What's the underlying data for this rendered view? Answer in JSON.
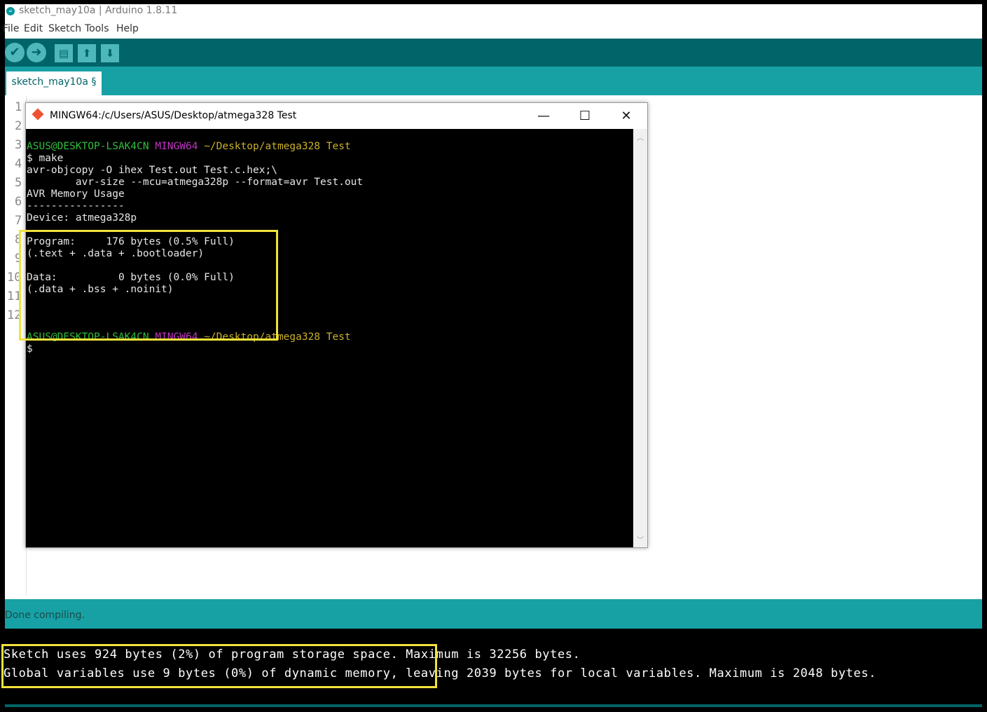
{
  "window": {
    "title": "sketch_may10a | Arduino 1.8.11",
    "logo_icon": "arduino-logo-icon"
  },
  "menu": [
    "File",
    "Edit",
    "Sketch",
    "Tools",
    "Help"
  ],
  "toolbar": {
    "verify_icon": "checkmark-icon",
    "upload_icon": "arrow-right-icon",
    "new_icon": "document-icon",
    "open_icon": "arrow-up-icon",
    "save_icon": "arrow-down-icon"
  },
  "tab": {
    "label": "sketch_may10a §"
  },
  "editor": {
    "line_numbers": [
      "1",
      "2",
      "3",
      "4",
      "5",
      "6",
      "7",
      "8",
      "9",
      "10",
      "11",
      "12"
    ]
  },
  "status": {
    "text": "Done compiling."
  },
  "console": {
    "line1_a": "Sketch uses 924 bytes (2%) of program storage space.",
    "line1_b": "Maximum is 32256 bytes.",
    "line2_a": "Global variables use 9 bytes (0%) of dynamic memory,",
    "line2_b": "leaving 2039 bytes for local variables. Maximum is 2048 bytes."
  },
  "terminal": {
    "title": "MINGW64:/c/Users/ASUS/Desktop/atmega328 Test",
    "prompt_user": "ASUS@DESKTOP-LSAK4CN",
    "prompt_host": "MINGW64",
    "prompt_path": "~/Desktop/atmega328 Test",
    "cmd": "$ make",
    "l_objcopy": "avr-objcopy -O ihex Test.out Test.c.hex;\\",
    "l_size": "        avr-size --mcu=atmega328p --format=avr Test.out",
    "l_usage": "AVR Memory Usage",
    "l_dash": "----------------",
    "l_device": "Device: atmega328p",
    "l_program": "Program:     176 bytes (0.5% Full)",
    "l_program_detail": "(.text + .data + .bootloader)",
    "l_data": "Data:          0 bytes (0.0% Full)",
    "l_data_detail": "(.data + .bss + .noinit)",
    "l_final_prompt": "$",
    "minimize": "—",
    "maximize": "☐",
    "close": "✕"
  }
}
